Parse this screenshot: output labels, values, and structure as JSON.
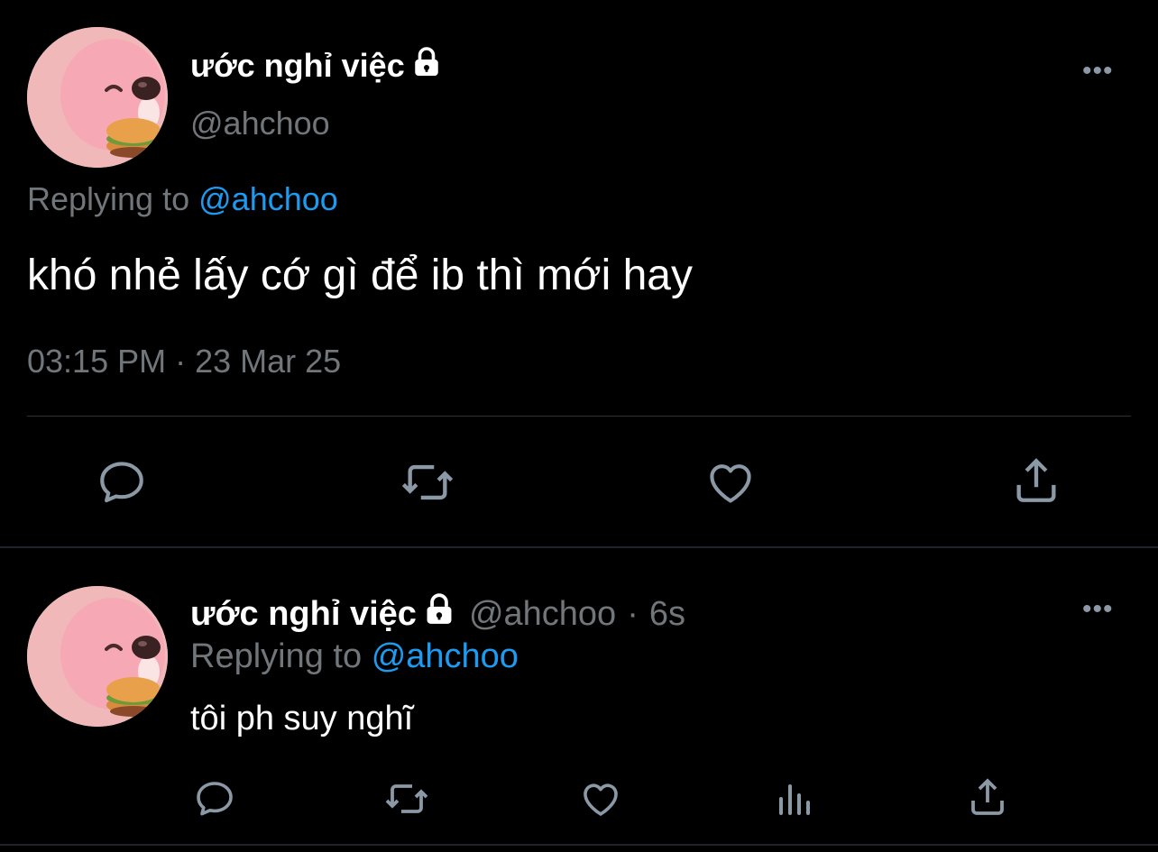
{
  "main_tweet": {
    "display_name": "ước nghỉ việc",
    "handle": "@ahchoo",
    "replying_prefix": "Replying to",
    "replying_handle": "@ahchoo",
    "text": "khó nhẻ lấy cớ gì để ib thì mới hay",
    "timestamp": "03:15 PM · 23 Mar 25",
    "actions": [
      "reply-icon",
      "retweet-icon",
      "like-icon",
      "share-icon"
    ]
  },
  "reply_tweet": {
    "display_name": "ước nghỉ việc",
    "handle": "@ahchoo",
    "time_sep": "·",
    "age": "6s",
    "replying_prefix": "Replying to",
    "replying_handle": "@ahchoo",
    "text": "tôi ph suy nghĩ",
    "actions": [
      "reply-icon",
      "retweet-icon",
      "like-icon",
      "views-icon",
      "share-icon"
    ]
  },
  "colors": {
    "background": "#000000",
    "text_primary": "#e7e9ea",
    "text_secondary": "#71767b",
    "accent": "#1d9bf0",
    "divider": "#2f3336"
  }
}
